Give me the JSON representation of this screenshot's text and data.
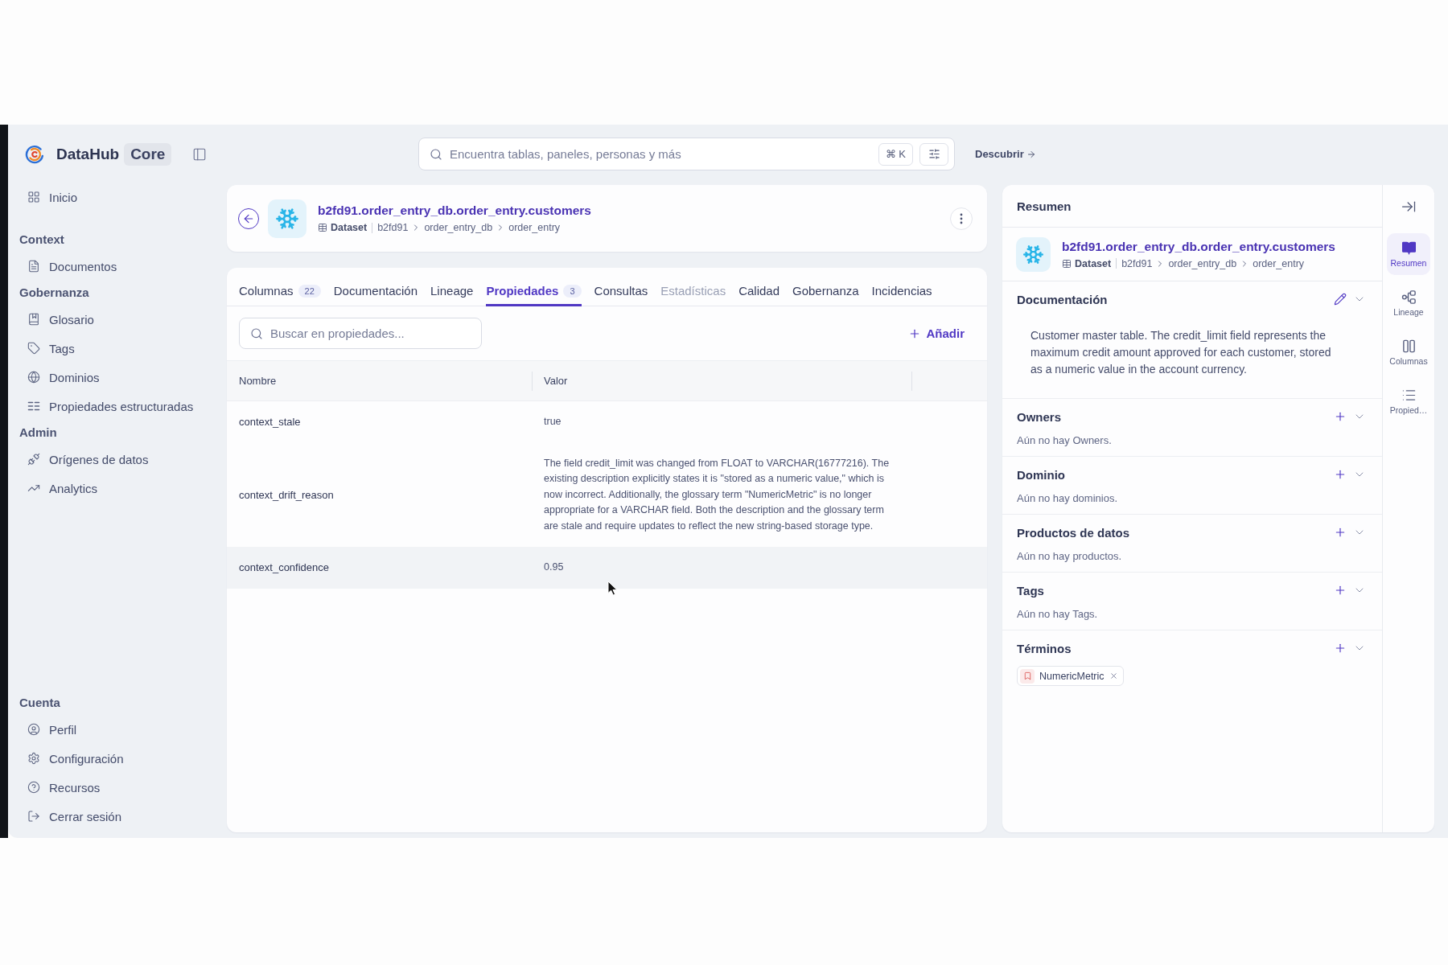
{
  "sidebar": {
    "brand": "DataHub",
    "edition": "Core",
    "groups": [
      {
        "items": [
          {
            "label": "Inicio",
            "selected": false
          }
        ]
      },
      {
        "title": "Context",
        "items": [
          {
            "label": "Documentos",
            "selected": false
          }
        ]
      },
      {
        "title": "Gobernanza",
        "items": [
          {
            "label": "Glosario",
            "selected": false
          },
          {
            "label": "Tags",
            "selected": false
          },
          {
            "label": "Dominios",
            "selected": false
          },
          {
            "label": "Propiedades estructuradas",
            "selected": false
          }
        ]
      },
      {
        "title": "Admin",
        "items": [
          {
            "label": "Orígenes de datos",
            "selected": false
          },
          {
            "label": "Analytics",
            "selected": false
          }
        ]
      }
    ],
    "account": {
      "title": "Cuenta",
      "items": [
        {
          "label": "Perfil",
          "selected": false
        },
        {
          "label": "Configuración",
          "selected": false
        },
        {
          "label": "Recursos",
          "selected": false
        },
        {
          "label": "Cerrar sesión",
          "selected": false
        }
      ]
    }
  },
  "search": {
    "placeholder": "Encuentra tablas, paneles, personas y más",
    "shortcut": "⌘ K"
  },
  "discover_link": "Descubrir",
  "entity": {
    "title": "b2fd91.order_entry_db.order_entry.customers",
    "type": "Dataset",
    "path": [
      "b2fd91",
      "order_entry_db",
      "order_entry"
    ]
  },
  "tabs": [
    {
      "label": "Columnas",
      "count": "22",
      "selected": false,
      "disabled": false
    },
    {
      "label": "Documentación",
      "selected": false,
      "disabled": false
    },
    {
      "label": "Lineage",
      "selected": false,
      "disabled": false
    },
    {
      "label": "Propiedades",
      "count": "3",
      "selected": true,
      "disabled": false
    },
    {
      "label": "Consultas",
      "selected": false,
      "disabled": false
    },
    {
      "label": "Estadísticas",
      "selected": false,
      "disabled": true
    },
    {
      "label": "Calidad",
      "selected": false,
      "disabled": false
    },
    {
      "label": "Gobernanza",
      "selected": false,
      "disabled": false
    },
    {
      "label": "Incidencias",
      "selected": false,
      "disabled": false
    }
  ],
  "properties": {
    "search_placeholder": "Buscar en propiedades...",
    "add_label": "Añadir",
    "columns": [
      "Nombre",
      "Valor"
    ],
    "rows": [
      {
        "name": "context_stale",
        "value": "true",
        "highlighted": false
      },
      {
        "name": "context_drift_reason",
        "value": "The field credit_limit was changed from FLOAT to VARCHAR(16777216). The existing description explicitly states it is \"stored as a numeric value,\" which is now incorrect. Additionally, the glossary term \"NumericMetric\" is no longer appropriate for a VARCHAR field. Both the description and the glossary term are stale and require updates to reflect the new string-based storage type.",
        "highlighted": false
      },
      {
        "name": "context_confidence",
        "value": "0.95",
        "highlighted": true
      }
    ]
  },
  "summary": {
    "title": "Resumen",
    "entity": {
      "title": "b2fd91.order_entry_db.order_entry.customers",
      "type": "Dataset",
      "path": [
        "b2fd91",
        "order_entry_db",
        "order_entry"
      ]
    },
    "sections": [
      {
        "title": "Documentación",
        "kind": "description",
        "expanded": true,
        "text": "Customer master table. The credit_limit field represents the maximum credit amount approved for each customer, stored as a numeric value in the account currency."
      },
      {
        "title": "Owners",
        "kind": "list",
        "expanded": true,
        "text": "Aún no hay Owners."
      },
      {
        "title": "Dominio",
        "kind": "list",
        "expanded": true,
        "text": "Aún no hay dominios."
      },
      {
        "title": "Productos de datos",
        "kind": "list",
        "expanded": true,
        "text": "Aún no hay productos."
      },
      {
        "title": "Tags",
        "kind": "list",
        "expanded": true,
        "text": "Aún no hay Tags."
      },
      {
        "title": "Términos",
        "kind": "list",
        "expanded": true,
        "terms": [
          {
            "label": "NumericMetric"
          }
        ]
      }
    ]
  },
  "rail": [
    {
      "label": "Resumen",
      "selected": true
    },
    {
      "label": "Lineage",
      "selected": false
    },
    {
      "label": "Columnas",
      "selected": false
    },
    {
      "label": "Propied…",
      "selected": false
    }
  ]
}
